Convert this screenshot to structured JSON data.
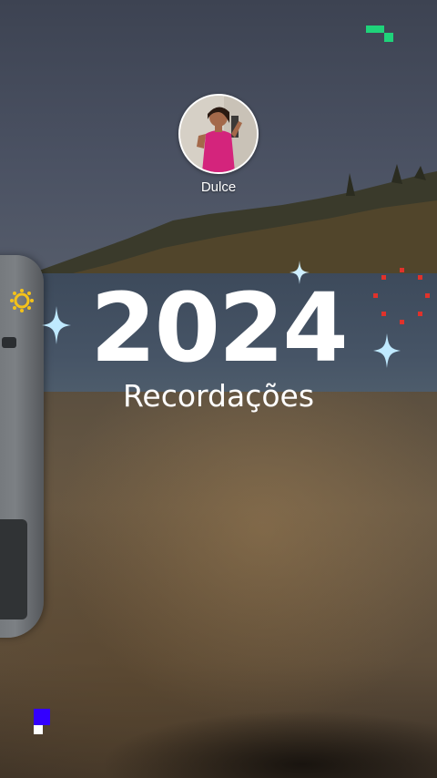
{
  "profile": {
    "name": "Dulce"
  },
  "title": {
    "year": "2024",
    "subtitle": "Recordações"
  },
  "colors": {
    "accent_green": "#1fd37a",
    "brand_blue": "#3300ff",
    "sparkle_blue": "#bfe9ff",
    "ring_red": "#e0322b",
    "sun_yellow": "#f4c21a"
  },
  "icons": [
    "sparkle-icon",
    "sun-icon",
    "red-dot-ring-icon",
    "pixel-logo-icon"
  ]
}
